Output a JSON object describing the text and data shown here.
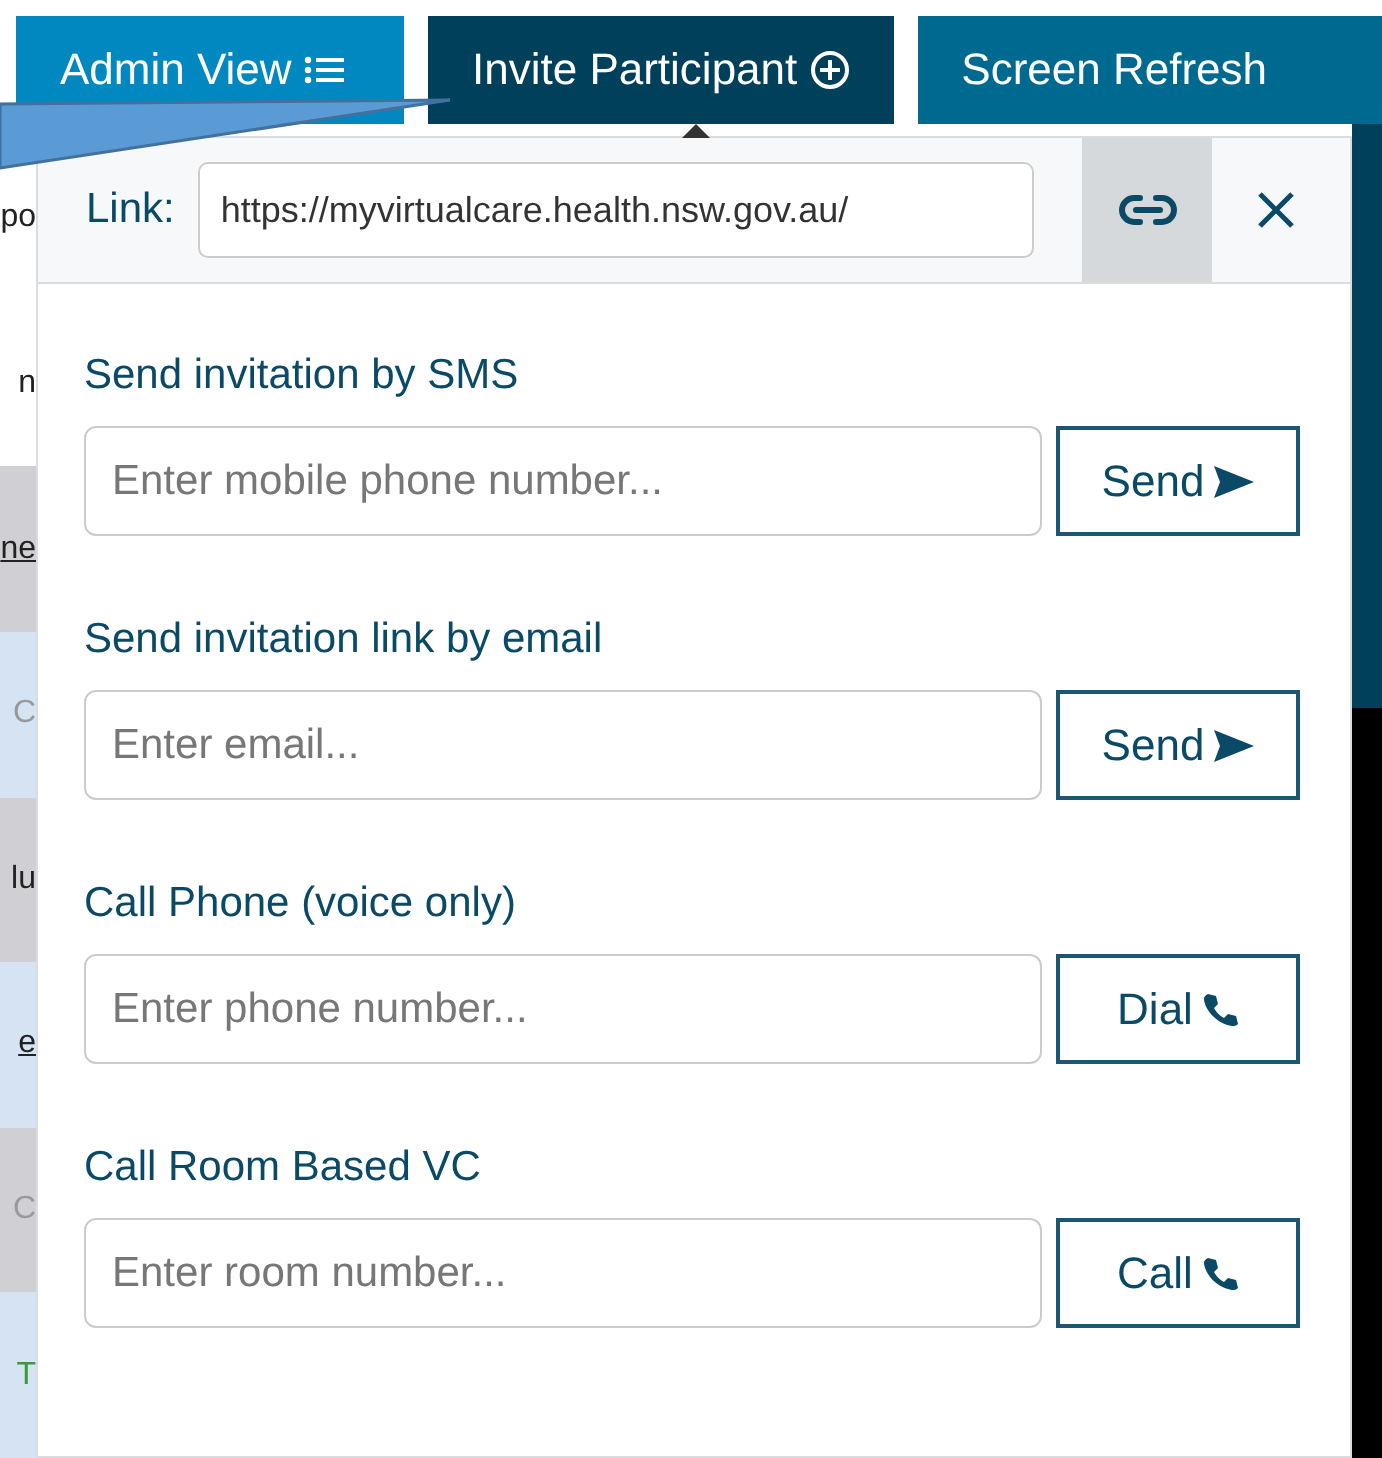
{
  "toolbar": {
    "buttons": [
      {
        "label": "Admin View",
        "kind": "list",
        "selected": false
      },
      {
        "label": "Invite Participant",
        "kind": "add",
        "selected": true
      },
      {
        "label": "Screen Refresh",
        "kind": "plain",
        "selected": false
      }
    ]
  },
  "background_fragments": [
    {
      "text": "po",
      "kind": "plain"
    },
    {
      "text": "n",
      "kind": "plain"
    },
    {
      "text": "ne",
      "kind": "link"
    },
    {
      "text": "C",
      "kind": "muted"
    },
    {
      "text": "lu",
      "kind": "plain"
    },
    {
      "text": "e",
      "kind": "link"
    },
    {
      "text": "C",
      "kind": "muted"
    },
    {
      "text": "T",
      "kind": "status"
    }
  ],
  "invite_panel": {
    "link": {
      "label": "Link:",
      "value": "https://myvirtualcare.health.nsw.gov.au/"
    },
    "sections": [
      {
        "title": "Send invitation by SMS",
        "placeholder": "Enter mobile phone number...",
        "button": "Send",
        "kind": "send"
      },
      {
        "title": "Send invitation link by email",
        "placeholder": "Enter email...",
        "button": "Send",
        "kind": "send"
      },
      {
        "title": "Call Phone (voice only)",
        "placeholder": "Enter phone number...",
        "button": "Dial",
        "kind": "call"
      },
      {
        "title": "Call Room Based VC",
        "placeholder": "Enter room number...",
        "button": "Call",
        "kind": "call"
      }
    ]
  }
}
